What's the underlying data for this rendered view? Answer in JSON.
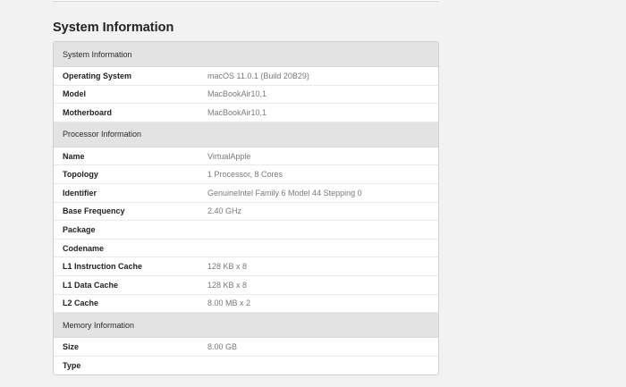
{
  "page_title": "System Information",
  "sections": [
    {
      "header": "System Information",
      "rows": [
        {
          "label": "Operating System",
          "value": "macOS 11.0.1 (Build 20B29)"
        },
        {
          "label": "Model",
          "value": "MacBookAir10,1"
        },
        {
          "label": "Motherboard",
          "value": "MacBookAir10,1"
        }
      ]
    },
    {
      "header": "Processor Information",
      "rows": [
        {
          "label": "Name",
          "value": "VirtualApple"
        },
        {
          "label": "Topology",
          "value": "1 Processor, 8 Cores"
        },
        {
          "label": "Identifier",
          "value": "GenuineIntel Family 6 Model 44 Stepping 0"
        },
        {
          "label": "Base Frequency",
          "value": "2.40 GHz"
        },
        {
          "label": "Package",
          "value": ""
        },
        {
          "label": "Codename",
          "value": ""
        },
        {
          "label": "L1 Instruction Cache",
          "value": "128 KB x 8"
        },
        {
          "label": "L1 Data Cache",
          "value": "128 KB x 8"
        },
        {
          "label": "L2 Cache",
          "value": "8.00 MB x 2"
        }
      ]
    },
    {
      "header": "Memory Information",
      "rows": [
        {
          "label": "Size",
          "value": "8.00 GB"
        },
        {
          "label": "Type",
          "value": ""
        }
      ]
    }
  ]
}
